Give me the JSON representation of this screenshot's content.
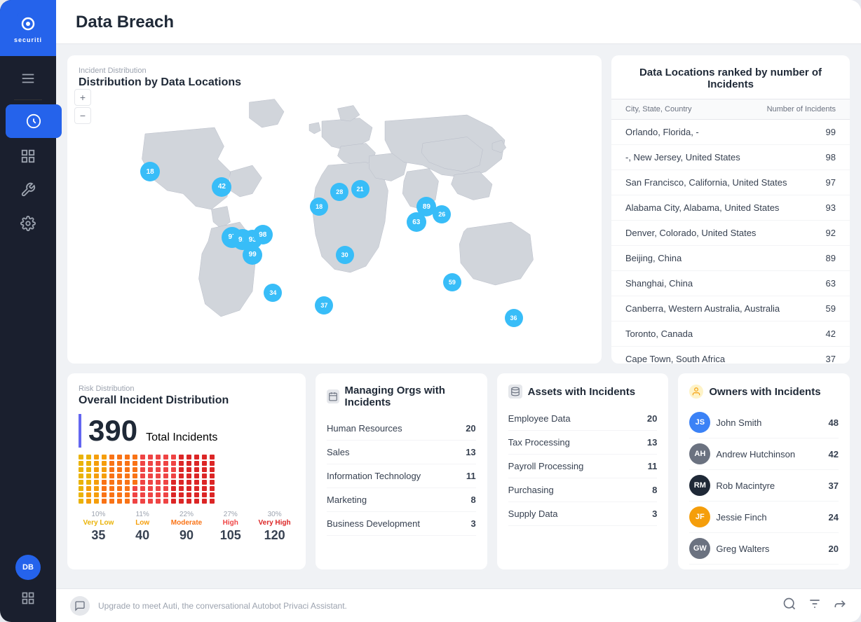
{
  "sidebar": {
    "logo_text": "securiti",
    "items": [
      {
        "name": "menu-icon",
        "label": "Menu"
      },
      {
        "name": "data-icon",
        "label": "Data"
      },
      {
        "name": "dashboard-icon",
        "label": "Dashboard"
      },
      {
        "name": "tools-icon",
        "label": "Tools"
      },
      {
        "name": "settings-icon",
        "label": "Settings"
      }
    ],
    "bottom": {
      "avatar": "DB",
      "grid": "Grid"
    }
  },
  "header": {
    "title": "Data Breach"
  },
  "map_section": {
    "subtitle": "Incident Distribution",
    "title": "Distribution by Data Locations",
    "bubbles": [
      {
        "value": "18",
        "left": "14%",
        "top": "30%",
        "size": 28
      },
      {
        "value": "42",
        "left": "28%",
        "top": "36%",
        "size": 28
      },
      {
        "value": "97",
        "left": "30%",
        "top": "56%",
        "size": 30
      },
      {
        "value": "92",
        "left": "32%",
        "top": "57%",
        "size": 30
      },
      {
        "value": "93",
        "left": "34%",
        "top": "57%",
        "size": 28
      },
      {
        "value": "98",
        "left": "36%",
        "top": "55%",
        "size": 28
      },
      {
        "value": "99",
        "left": "34%",
        "top": "63%",
        "size": 28
      },
      {
        "value": "18",
        "left": "47%",
        "top": "44%",
        "size": 26
      },
      {
        "value": "28",
        "left": "51%",
        "top": "38%",
        "size": 26
      },
      {
        "value": "21",
        "left": "55%",
        "top": "37%",
        "size": 26
      },
      {
        "value": "30",
        "left": "52%",
        "top": "63%",
        "size": 26
      },
      {
        "value": "34",
        "left": "38%",
        "top": "78%",
        "size": 26
      },
      {
        "value": "37",
        "left": "48%",
        "top": "83%",
        "size": 26
      },
      {
        "value": "89",
        "left": "68%",
        "top": "44%",
        "size": 28
      },
      {
        "value": "26",
        "left": "71%",
        "top": "47%",
        "size": 26
      },
      {
        "value": "63",
        "left": "66%",
        "top": "50%",
        "size": 28
      },
      {
        "value": "59",
        "left": "73%",
        "top": "74%",
        "size": 26
      },
      {
        "value": "36",
        "left": "85%",
        "top": "88%",
        "size": 26
      }
    ]
  },
  "locations": {
    "title": "Data Locations ranked by number of Incidents",
    "col_city": "City, State, Country",
    "col_incidents": "Number of Incidents",
    "rows": [
      {
        "city": "Orlando, Florida, -",
        "count": "99"
      },
      {
        "city": "-, New Jersey, United States",
        "count": "98"
      },
      {
        "city": "San Francisco, California, United States",
        "count": "97"
      },
      {
        "city": "Alabama City, Alabama, United States",
        "count": "93"
      },
      {
        "city": "Denver, Colorado, United States",
        "count": "92"
      },
      {
        "city": "Beijing, China",
        "count": "89"
      },
      {
        "city": "Shanghai, China",
        "count": "63"
      },
      {
        "city": "Canberra, Western Australia, Australia",
        "count": "59"
      },
      {
        "city": "Toronto, Canada",
        "count": "42"
      },
      {
        "city": "Cape Town, South Africa",
        "count": "37"
      }
    ]
  },
  "risk_distribution": {
    "subtitle": "Risk Distribution",
    "title": "Overall Incident Distribution",
    "total": "390",
    "total_label": "Total Incidents",
    "categories": [
      {
        "pct": "10%",
        "label": "Very Low",
        "count": "35",
        "color": "#eab308"
      },
      {
        "pct": "11%",
        "label": "Low",
        "count": "40",
        "color": "#f59e0b"
      },
      {
        "pct": "22%",
        "label": "Moderate",
        "count": "90",
        "color": "#f97316"
      },
      {
        "pct": "27%",
        "label": "High",
        "count": "105",
        "color": "#ef4444"
      },
      {
        "pct": "30%",
        "label": "Very High",
        "count": "120",
        "color": "#dc2626"
      }
    ]
  },
  "managing_orgs": {
    "title": "Managing Orgs with Incidents",
    "rows": [
      {
        "name": "Human Resources",
        "count": "20"
      },
      {
        "name": "Sales",
        "count": "13"
      },
      {
        "name": "Information Technology",
        "count": "11"
      },
      {
        "name": "Marketing",
        "count": "8"
      },
      {
        "name": "Business Development",
        "count": "3"
      }
    ]
  },
  "assets": {
    "title": "Assets with Incidents",
    "rows": [
      {
        "name": "Employee Data",
        "count": "20"
      },
      {
        "name": "Tax Processing",
        "count": "13"
      },
      {
        "name": "Payroll Processing",
        "count": "11"
      },
      {
        "name": "Purchasing",
        "count": "8"
      },
      {
        "name": "Supply Data",
        "count": "3"
      }
    ]
  },
  "owners": {
    "title": "Owners with Incidents",
    "rows": [
      {
        "name": "John Smith",
        "count": "48",
        "color": "#3b82f6"
      },
      {
        "name": "Andrew Hutchinson",
        "count": "42",
        "color": "#6b7280"
      },
      {
        "name": "Rob Macintyre",
        "count": "37",
        "color": "#1f2937"
      },
      {
        "name": "Jessie Finch",
        "count": "24",
        "color": "#f59e0b"
      },
      {
        "name": "Greg Walters",
        "count": "20",
        "color": "#6b7280"
      }
    ]
  },
  "bottom_bar": {
    "chat_text": "Upgrade to meet Auti, the conversational Autobot Privaci Assistant."
  }
}
